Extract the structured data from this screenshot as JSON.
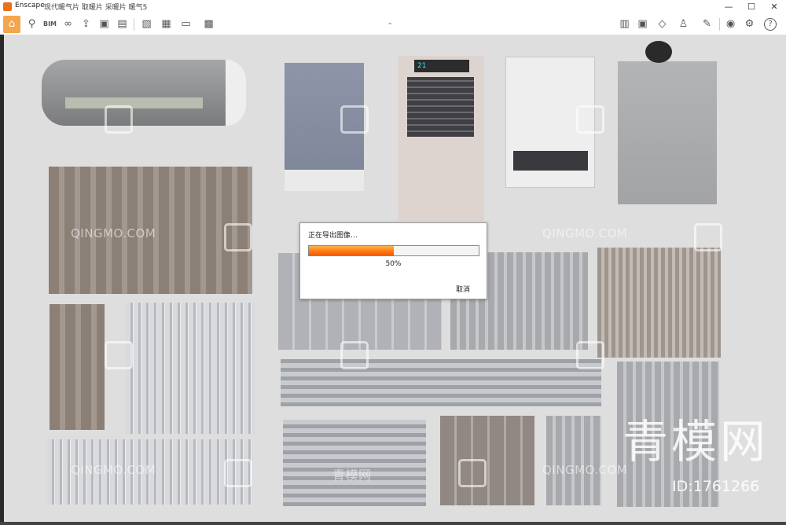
{
  "window": {
    "app_name": "Enscape",
    "doc_title": "现代暖气片 取暖片 采暖片 暖气5",
    "minimize_glyph": "—",
    "maximize_glyph": "☐",
    "close_glyph": "✕"
  },
  "toolbar": {
    "home_icon": "home-icon",
    "left_icons": [
      "location-icon",
      "bim-icon",
      "binoculars-icon",
      "export-icon",
      "box-icon",
      "scene-icon",
      "clapper-icon",
      "screenshot-icon",
      "batch-render-icon",
      "video-export-icon",
      "exe-export-icon"
    ],
    "right_icons": [
      "map-icon",
      "panorama-icon",
      "cube-icon",
      "asset-icon",
      "settings-tool-icon",
      "eye-icon",
      "gear-icon",
      "help-icon"
    ],
    "help_glyph": "?"
  },
  "viewport": {
    "watermarks": {
      "small_text": "QINGMO.COM",
      "big_text": "青模网",
      "center_text": "青模网",
      "id_text": "ID:1761266"
    },
    "heater_display": "21"
  },
  "dialog": {
    "title": "正在导出图像…",
    "progress_percent": 50,
    "progress_text": "50%",
    "cancel_label": "取消",
    "accent": "#ff7a10"
  }
}
